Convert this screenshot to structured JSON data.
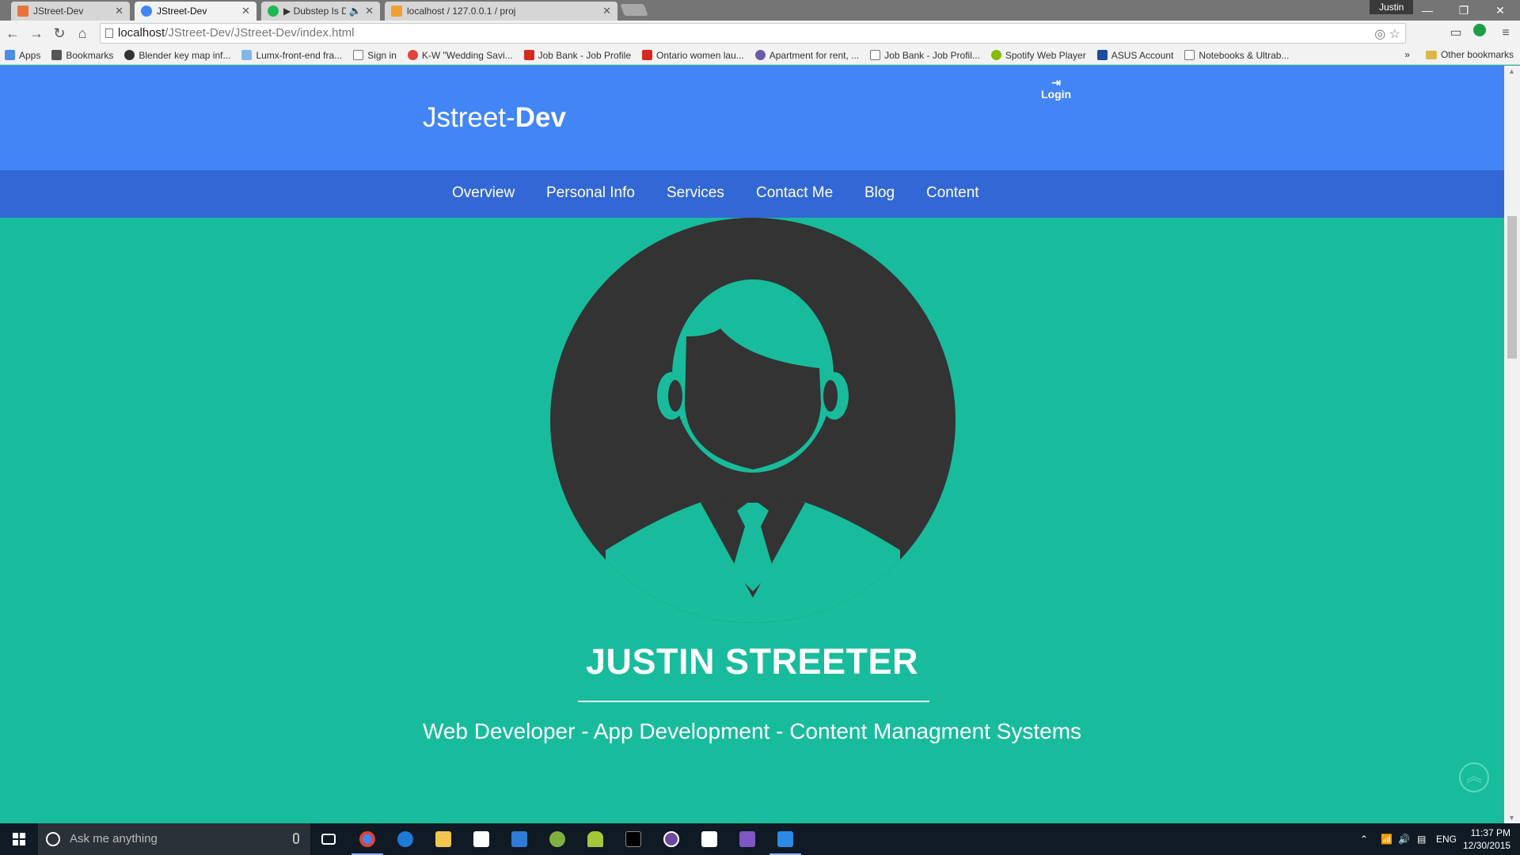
{
  "browser": {
    "tabs": [
      {
        "title": "JStreet-Dev",
        "fav_color": "#e8743b",
        "active": false
      },
      {
        "title": "JStreet-Dev",
        "fav_color": "#4285f4",
        "active": true
      },
      {
        "title": "▶ Dubstep Is Dead - G",
        "fav_color": "#1db954",
        "active": false
      },
      {
        "title": "localhost / 127.0.0.1 / proj",
        "fav_color": "#f0a030",
        "active": false
      }
    ],
    "profile_name": "Justin",
    "window_controls": {
      "minimize": "—",
      "restore": "❐",
      "close": "✕"
    },
    "url_host": "localhost",
    "url_path": "/JStreet-Dev/JStreet-Dev/index.html",
    "bookmarks": [
      {
        "label": "Apps",
        "icon": "apps-grid-icon",
        "color": "#4a8fe7"
      },
      {
        "label": "Bookmarks",
        "icon": "star-icon",
        "color": "#555555"
      },
      {
        "label": "Blender key map inf...",
        "icon": "blender-icon",
        "color": "#333333"
      },
      {
        "label": "Lumx-front-end fra...",
        "icon": "lumx-icon",
        "color": "#7fb8e8"
      },
      {
        "label": "Sign in",
        "icon": "page-icon",
        "color": "#ffffff"
      },
      {
        "label": "K-W \"Wedding Savi...",
        "icon": "kw-icon",
        "color": "#e0443a"
      },
      {
        "label": "Job Bank - Job Profile",
        "icon": "maple-leaf-icon",
        "color": "#d52b1e"
      },
      {
        "label": "Ontario women lau...",
        "icon": "ctv-icon",
        "color": "#d52b1e"
      },
      {
        "label": "Apartment for rent, ...",
        "icon": "kijiji-icon",
        "color": "#6d5aa8"
      },
      {
        "label": "Job Bank - Job Profil...",
        "icon": "page-icon",
        "color": "#ffffff"
      },
      {
        "label": "Spotify Web Player",
        "icon": "spotify-icon",
        "color": "#84bd00"
      },
      {
        "label": "ASUS Account",
        "icon": "asus-icon",
        "color": "#1d4ba0"
      },
      {
        "label": "Notebooks & Ultrab...",
        "icon": "page-icon",
        "color": "#ffffff"
      }
    ],
    "bookmarks_overflow": "»",
    "other_bookmarks": "Other bookmarks"
  },
  "site": {
    "brand_prefix": "Jstreet-",
    "brand_bold": "Dev",
    "login_label": "Login",
    "nav": [
      "Overview",
      "Personal Info",
      "Services",
      "Contact Me",
      "Blog",
      "Content"
    ],
    "hero_name": "JUSTIN STREETER",
    "hero_tagline": "Web Developer - App Development - Content Managment Systems",
    "colors": {
      "header": "#4285f4",
      "nav": "#3367d6",
      "hero": "#18bc9c",
      "avatar": "#333333"
    }
  },
  "taskbar": {
    "search_placeholder": "Ask me anything",
    "apps": [
      {
        "name": "task-view-icon",
        "color": "#ffffff"
      },
      {
        "name": "chrome-icon",
        "color": "#4285f4",
        "open": true
      },
      {
        "name": "edge-icon",
        "color": "#1f7ad6"
      },
      {
        "name": "file-explorer-icon",
        "color": "#f2c54e"
      },
      {
        "name": "store-icon",
        "color": "#ffffff"
      },
      {
        "name": "sourcetree-icon",
        "color": "#2f7ad6"
      },
      {
        "name": "android-studio-icon",
        "color": "#7fb142"
      },
      {
        "name": "android-icon",
        "color": "#a4c639"
      },
      {
        "name": "terminal-icon",
        "color": "#222222"
      },
      {
        "name": "gitkraken-icon",
        "color": "#6c4aa3"
      },
      {
        "name": "calendar-app-icon",
        "color": "#ffffff"
      },
      {
        "name": "visual-studio-icon",
        "color": "#7e57c2"
      },
      {
        "name": "vs-code-icon",
        "color": "#2b8ce6",
        "open": true
      }
    ],
    "language": "ENG",
    "time": "11:37 PM",
    "date": "12/30/2015"
  }
}
